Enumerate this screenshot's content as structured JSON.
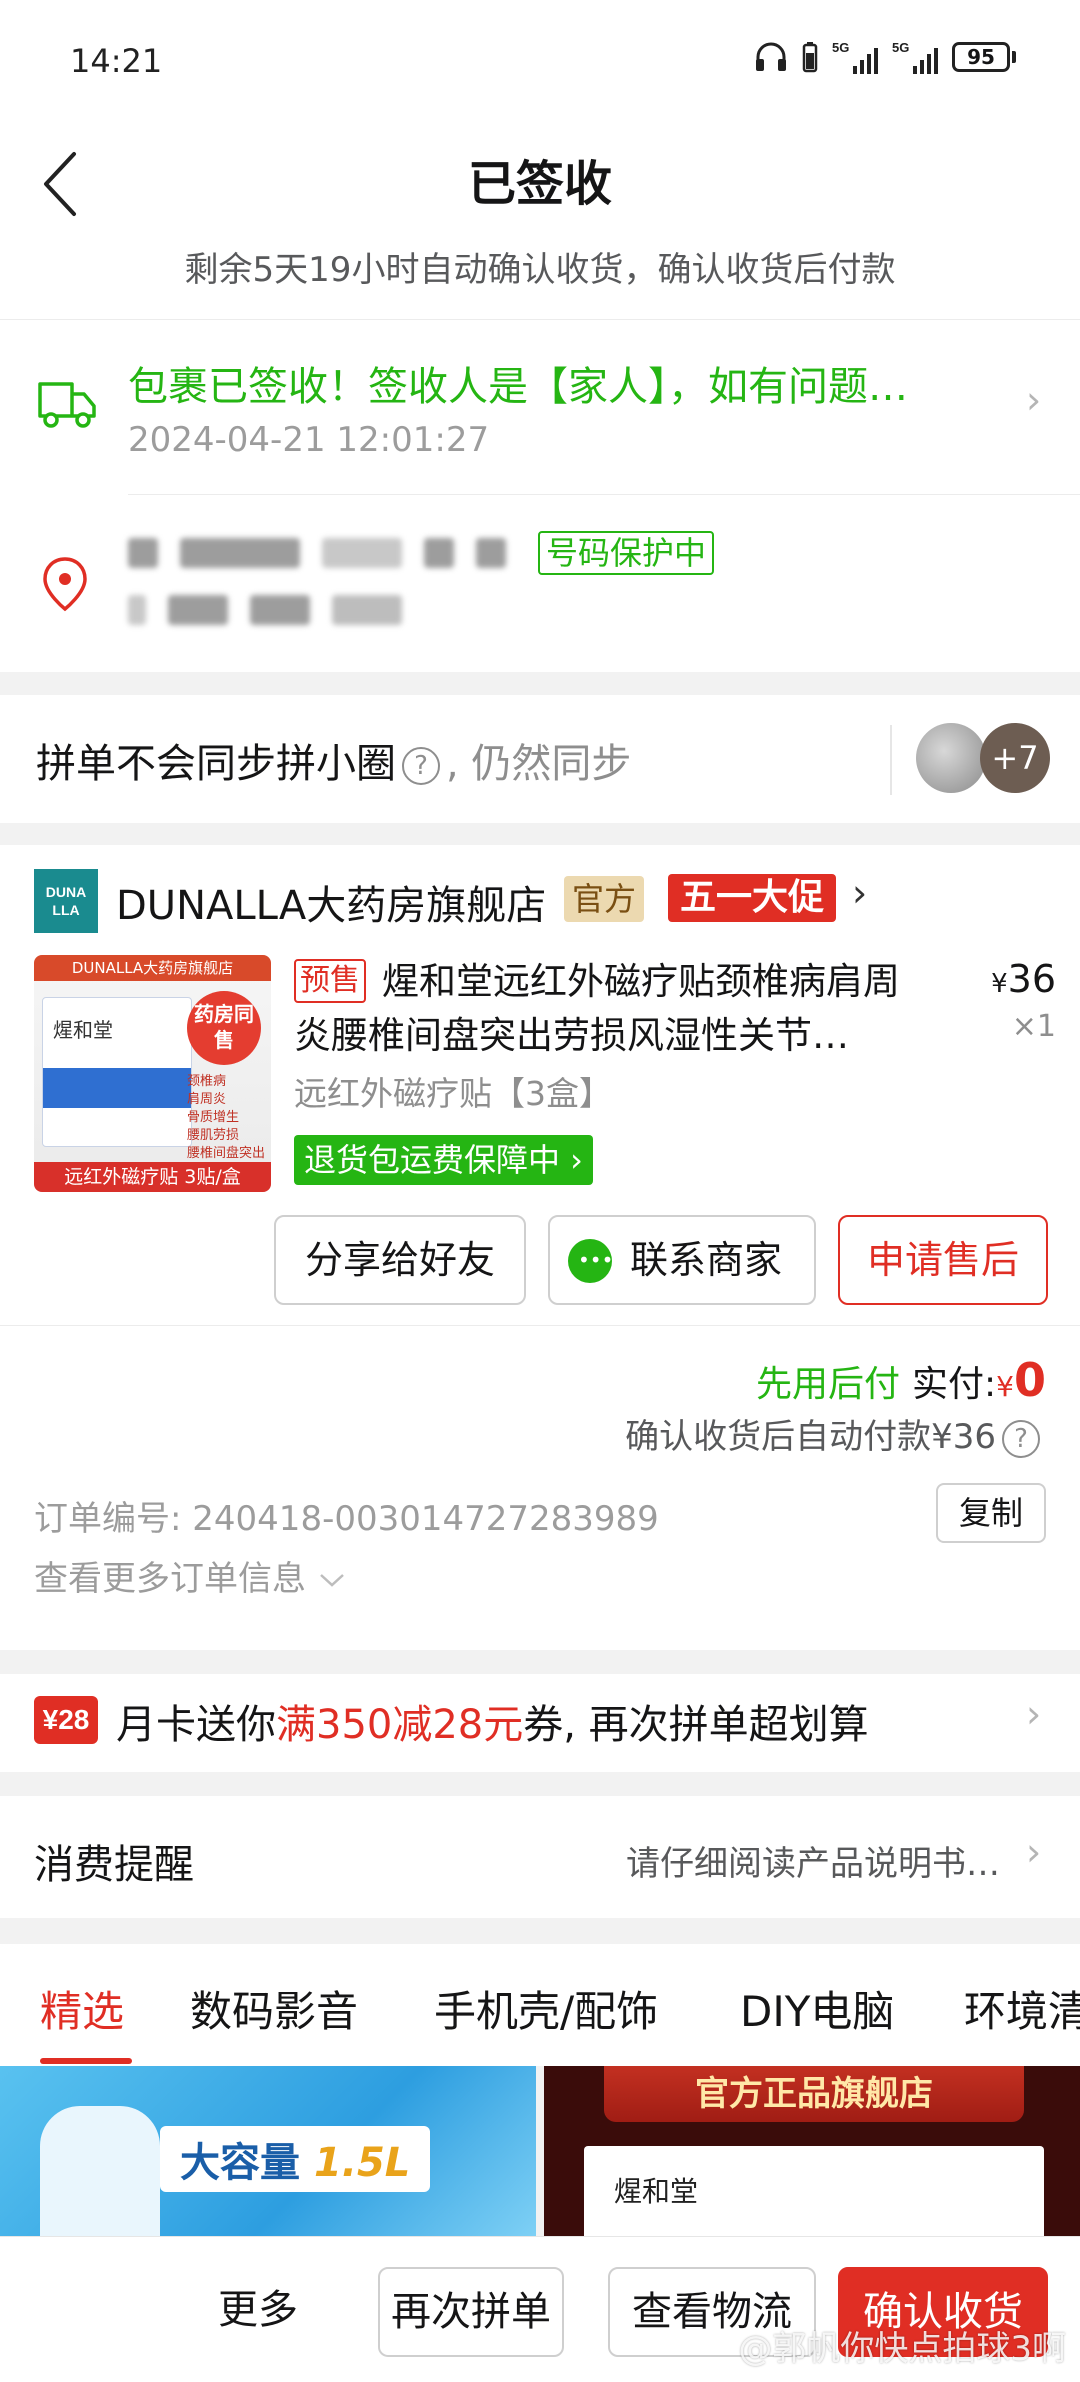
{
  "status_bar": {
    "time": "14:21",
    "battery": "95",
    "network1": "5G",
    "network2": "5G"
  },
  "header": {
    "title": "已签收",
    "subtitle": "剩余5天19小时自动确认收货，确认收货后付款"
  },
  "logistics": {
    "status": "包裹已签收！签收人是【家人】，如有问题…",
    "time": "2024-04-21 12:01:27"
  },
  "address": {
    "phone_protection": "号码保护中"
  },
  "group": {
    "text": "拼单不会同步拼小圈",
    "sync": ", 仍然同步",
    "more_count": "+7"
  },
  "shop": {
    "logo_text": "DUNA LLA",
    "name": "DUNALLA大药房旗舰店",
    "official_badge": "官方",
    "promo_badge": "五一大促"
  },
  "product": {
    "presale_tag": "预售",
    "title": "煋和堂远红外磁疗贴颈椎病肩周炎腰椎间盘突出劳损风湿性关节…",
    "price_symbol": "¥",
    "price": "36",
    "quantity": "×1",
    "spec": "远红外磁疗贴【3盒】",
    "return_badge": "退货包运费保障中 ›",
    "image": {
      "top_text": "DUNALLA大药房旗舰店",
      "box_text": "煋和堂",
      "stamp": "药房同售",
      "list": [
        "颈椎病",
        "肩周炎",
        "骨质增生",
        "腰肌劳损",
        "腰椎间盘突出"
      ],
      "bottom_text": "远红外磁疗贴 3贴/盒"
    }
  },
  "actions": {
    "share": "分享给好友",
    "contact": "联系商家",
    "aftersale": "申请售后"
  },
  "payment": {
    "pay_later": "先用后付",
    "paid_label": "实付:",
    "symbol": "¥",
    "amount": "0",
    "autopay_note": "确认收货后自动付款¥36"
  },
  "order": {
    "number_label": "订单编号:",
    "number": "240418-003014727283989",
    "copy": "复制",
    "more_info": "查看更多订单信息"
  },
  "coupon": {
    "icon_text": "¥28",
    "prefix": "月卡送你",
    "highlight": "满350减28元",
    "suffix": "券, 再次拼单超划算"
  },
  "reminder": {
    "title": "消费提醒",
    "note": "请仔细阅读产品说明书…"
  },
  "tabs": [
    "精选",
    "数码影音",
    "手机壳/配饰",
    "DIY电脑",
    "环境清"
  ],
  "recommend": {
    "item1_label_main": "大容量 ",
    "item1_label_size": "1.5L",
    "item2_banner": "官方正品旗舰店",
    "item2_brand": "煋和堂"
  },
  "bottom_bar": {
    "more": "更多",
    "reorder": "再次拼单",
    "track": "查看物流",
    "confirm": "确认收货"
  },
  "watermark": "@郭帆你快点拍球3啊",
  "colors": {
    "brand_red": "#e02e24",
    "green": "#25b513"
  }
}
